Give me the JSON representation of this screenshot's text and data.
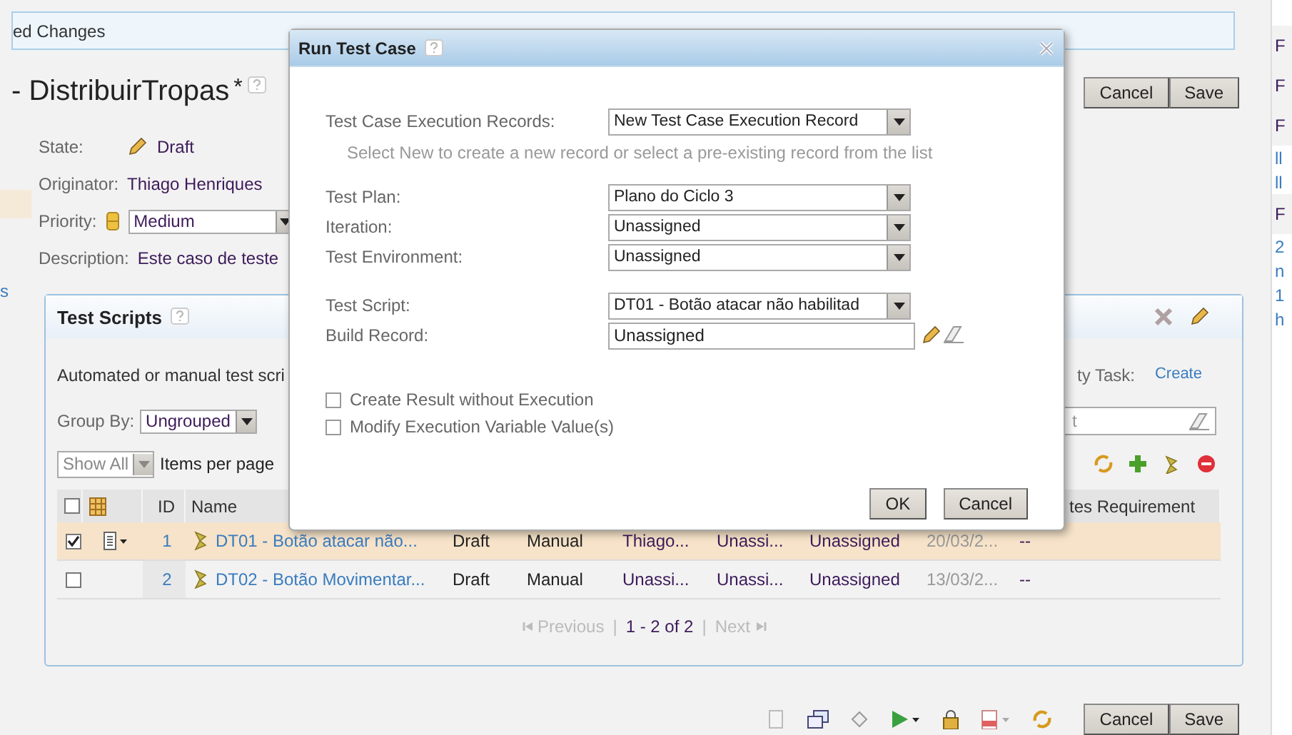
{
  "banner": {
    "text": "ed Changes"
  },
  "header": {
    "title": "- DistribuirTropas",
    "modified_mark": "*",
    "buttons": [
      "Cancel",
      "Save"
    ]
  },
  "fields": [
    {
      "label": "State:",
      "value": "Draft",
      "kind": "state"
    },
    {
      "label": "Originator:",
      "value": "Thiago Henriques",
      "kind": "text"
    },
    {
      "label": "Priority:",
      "value": "Medium",
      "kind": "select"
    },
    {
      "label": "Description:",
      "value": "Este caso de teste",
      "kind": "text"
    }
  ],
  "left_edge": "s",
  "test_scripts": {
    "title": "Test Scripts",
    "description": "Automated or manual test scri",
    "task_label": "ty Task:",
    "task_link": "Create",
    "group_by": {
      "label": "Group By:",
      "value": "Ungrouped"
    },
    "filter": {
      "value": "t"
    },
    "page_size": {
      "value": "Show All",
      "label": "Items per page",
      "disabled": true
    },
    "header_checked": false,
    "columns": [
      "ID",
      "Name",
      "tes Requirement"
    ],
    "rows": [
      {
        "selected": true,
        "checked": true,
        "id": "1",
        "name": "DT01 - Botão atacar não...",
        "cells": [
          "Draft",
          "Manual",
          "Thiago...",
          "Unassi...",
          "Unassigned",
          "20/03/2...",
          "--"
        ]
      },
      {
        "selected": false,
        "checked": false,
        "id": "2",
        "name": "DT02 - Botão Movimentar...",
        "cells": [
          "Draft",
          "Manual",
          "Unassi...",
          "Unassi...",
          "Unassigned",
          "13/03/2...",
          "--"
        ]
      }
    ],
    "pager": {
      "previous": "Previous",
      "separators": [
        "|",
        "|"
      ],
      "range": "1 - 2 of 2",
      "next": "Next"
    }
  },
  "bottom_toolbar": {
    "buttons": [
      "Cancel",
      "Save"
    ]
  },
  "sidebar": {
    "lines": [
      {
        "text": "F",
        "kind": "header"
      },
      {
        "text": "F",
        "kind": "header"
      },
      {
        "text": "F",
        "kind": "header"
      },
      {
        "text": "ll",
        "kind": "link"
      },
      {
        "text": "ll",
        "kind": "link"
      },
      {
        "text": "F",
        "kind": "header"
      },
      {
        "text": "2",
        "kind": "link"
      },
      {
        "text": "n",
        "kind": "link"
      },
      {
        "text": "1",
        "kind": "link"
      },
      {
        "text": "h",
        "kind": "link"
      }
    ]
  },
  "dialog": {
    "title": "Run Test Case",
    "sections": [
      {
        "fields": [
          {
            "label": "Test Case Execution Records:",
            "value": "New Test Case Execution Record",
            "kind": "select",
            "hint": "Select New to create a new record or select a pre-existing record from the list"
          }
        ]
      },
      {
        "fields": [
          {
            "label": "Test Plan:",
            "value": "Plano do Ciclo 3",
            "kind": "select"
          },
          {
            "label": "Iteration:",
            "value": "Unassigned",
            "kind": "select"
          },
          {
            "label": "Test Environment:",
            "value": "Unassigned",
            "kind": "select"
          }
        ]
      },
      {
        "fields": [
          {
            "label": "Test Script:",
            "value": "DT01 - Botão atacar não habilitad",
            "kind": "select"
          },
          {
            "label": "Build Record:",
            "value": "Unassigned",
            "kind": "lookup"
          }
        ]
      }
    ],
    "checkboxes": [
      {
        "label": "Create Result without Execution",
        "checked": false
      },
      {
        "label": "Modify Execution Variable Value(s)",
        "checked": false
      }
    ],
    "buttons": [
      "OK",
      "Cancel"
    ]
  }
}
